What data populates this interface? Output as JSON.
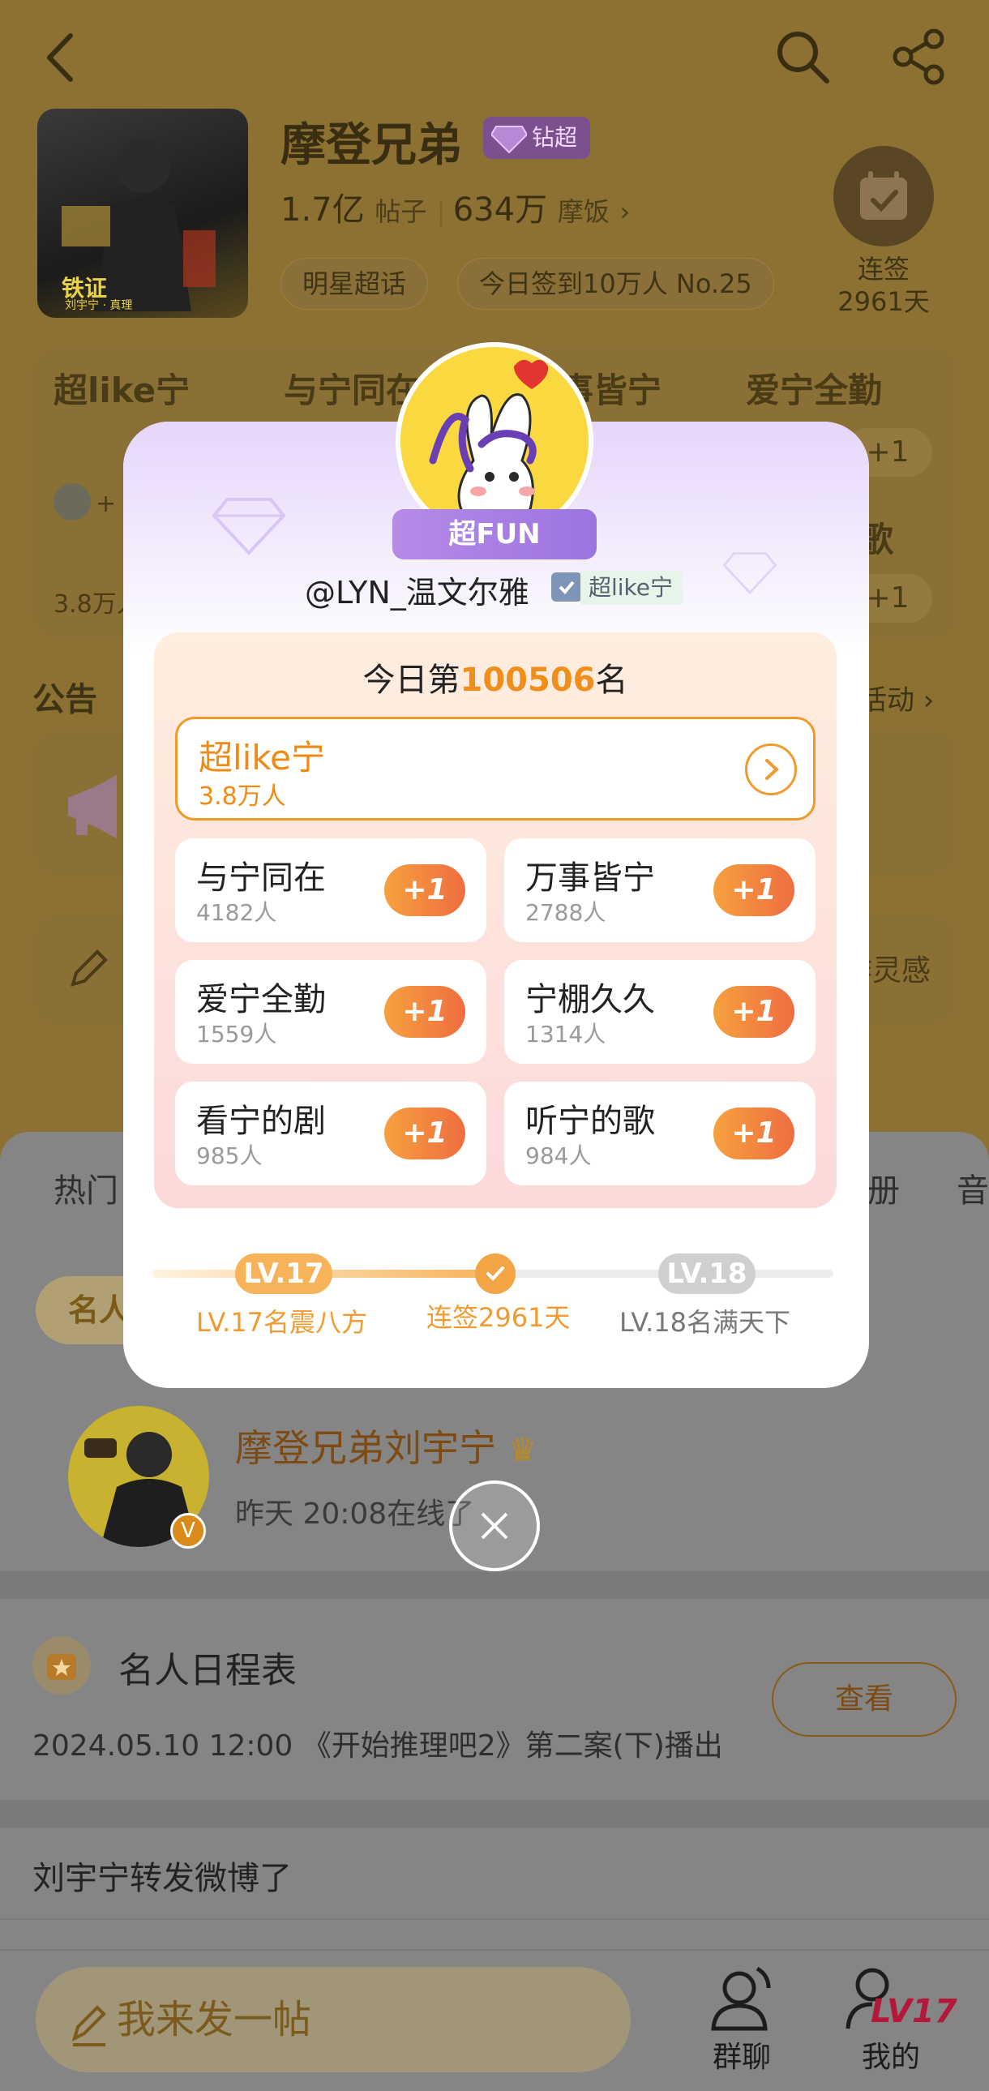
{
  "header": {
    "topic_name": "摩登兄弟",
    "diamond_label": "钻超",
    "posts_count": "1.7亿",
    "posts_label": "帖子",
    "fans_count": "634万",
    "fans_label": "摩饭",
    "tag1": "明星超话",
    "tag2": "今日签到10万人 No.25",
    "signin_label": "连签",
    "signin_days": "2961天",
    "cover_text": "刘宇宁 · 真理"
  },
  "bg_ranks": {
    "col1": "超like宁",
    "col2": "与宁同在",
    "col3": "事皆宁",
    "col4": "爱宁全勤",
    "col4b": "歌",
    "plus": "+1",
    "count": "3.8万人",
    "side_plus": "+"
  },
  "notice": {
    "title": "公告",
    "link": "活动",
    "card2_text": "作灵感"
  },
  "lower": {
    "tab_hot": "热门",
    "tab_album": "册",
    "tab_music": "音",
    "chip": "名人",
    "star_name": "摩登兄弟刘宇宁",
    "star_online": "昨天 20:08在线了",
    "sched_title": "名人日程表",
    "sched_text": "2024.05.10 12:00 《开始推理吧2》第二案(下)播出",
    "view_button": "查看",
    "repost_text": "刘宇宁转发微博了"
  },
  "bottom_bar": {
    "post_placeholder": "我来发一帖",
    "group_chat": "群聊",
    "mine": "我的",
    "level_badge": "LV17"
  },
  "dialog": {
    "fun_badge": "超FUN",
    "username": "@LYN_温文尔雅",
    "user_tag": "超like宁",
    "today_prefix": "今日第",
    "today_rank": "100506",
    "today_suffix": "名",
    "main": {
      "title": "超like宁",
      "count": "3.8万人"
    },
    "items": [
      {
        "title": "与宁同在",
        "count": "4182人",
        "btn": "+1"
      },
      {
        "title": "万事皆宁",
        "count": "2788人",
        "btn": "+1"
      },
      {
        "title": "爱宁全勤",
        "count": "1559人",
        "btn": "+1"
      },
      {
        "title": "宁棚久久",
        "count": "1314人",
        "btn": "+1"
      },
      {
        "title": "看宁的剧",
        "count": "985人",
        "btn": "+1"
      },
      {
        "title": "听宁的歌",
        "count": "984人",
        "btn": "+1"
      }
    ],
    "level": {
      "current_chip": "LV.17",
      "current_label": "LV.17名震八方",
      "streak_label": "连签2961天",
      "next_chip": "LV.18",
      "next_label": "LV.18名满天下",
      "progress": 0.5
    }
  },
  "colors": {
    "accent": "#f08e1c",
    "dialog_bg": "#ffffff",
    "purple": "#9b74e0",
    "plus_gradient_start": "#f6a13e",
    "plus_gradient_end": "#ef6d40"
  },
  "icons": [
    "back-icon",
    "search-icon",
    "share-icon",
    "calendar-check-icon",
    "megaphone-icon",
    "pen-icon",
    "crown-icon",
    "calendar-star-icon",
    "group-chat-icon",
    "profile-icon",
    "close-icon",
    "chevron-right-icon",
    "checkmark-icon"
  ]
}
